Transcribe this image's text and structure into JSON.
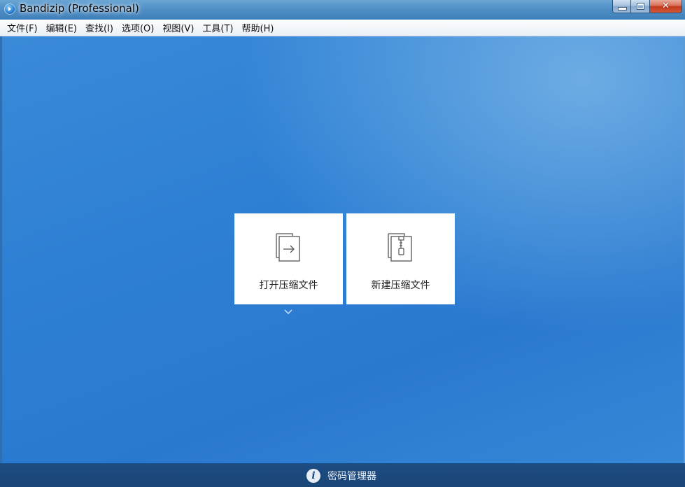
{
  "window": {
    "title": "Bandizip (Professional)"
  },
  "menu": {
    "items": [
      {
        "label": "文件(F)"
      },
      {
        "label": "编辑(E)"
      },
      {
        "label": "查找(I)"
      },
      {
        "label": "选项(O)"
      },
      {
        "label": "视图(V)"
      },
      {
        "label": "工具(T)"
      },
      {
        "label": "帮助(H)"
      }
    ]
  },
  "main": {
    "open_archive_label": "打开压缩文件",
    "new_archive_label": "新建压缩文件"
  },
  "footer": {
    "password_manager_label": "密码管理器"
  },
  "colors": {
    "background": "#2d7fd4",
    "footer": "#1d4c82",
    "tile": "#ffffff"
  }
}
